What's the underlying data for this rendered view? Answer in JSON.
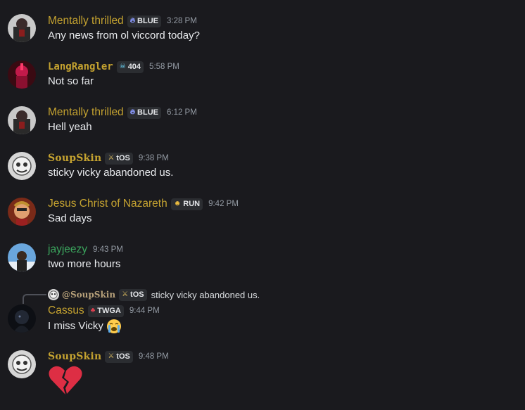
{
  "messages": [
    {
      "author": "Mentally thrilled",
      "color": "#c4a230",
      "tag_icon": "fire-icon",
      "tag": "BLUE",
      "time": "3:28 PM",
      "text": "Any news from ol viccord today?"
    },
    {
      "author": "LangRangler",
      "color": "#c4a230",
      "tag_icon": "skull-icon",
      "tag": "404",
      "time": "5:58 PM",
      "text": "Not so far"
    },
    {
      "author": "Mentally thrilled",
      "color": "#c4a230",
      "tag_icon": "fire-icon",
      "tag": "BLUE",
      "time": "6:12 PM",
      "text": "Hell yeah"
    },
    {
      "author": "SoupSkin",
      "color": "#c4a230",
      "tag_icon": "sword-icon",
      "tag": "tOS",
      "time": "9:38 PM",
      "text": "sticky vicky abandoned us."
    },
    {
      "author": "Jesus Christ of Nazareth",
      "color": "#c4a230",
      "tag_icon": "angry-face-icon",
      "tag": "RUN",
      "time": "9:42 PM",
      "text": "Sad days"
    },
    {
      "author": "jayjeezy",
      "color": "#3ba55d",
      "time": "9:43 PM",
      "text": "two more hours"
    },
    {
      "author": "Cassus",
      "color": "#c4a230",
      "tag_icon": "mushroom-icon",
      "tag": "TWGA",
      "time": "9:44 PM",
      "text": "I miss Vicky",
      "emoji": "loudly-crying-face"
    },
    {
      "author": "SoupSkin",
      "color": "#c4a230",
      "tag_icon": "sword-icon",
      "tag": "tOS",
      "time": "9:48 PM",
      "emoji": "broken-heart"
    }
  ],
  "reply": {
    "author": "@SoupSkin",
    "tag_icon": "sword-icon",
    "tag": "tOS",
    "text": "sticky vicky abandoned us."
  }
}
